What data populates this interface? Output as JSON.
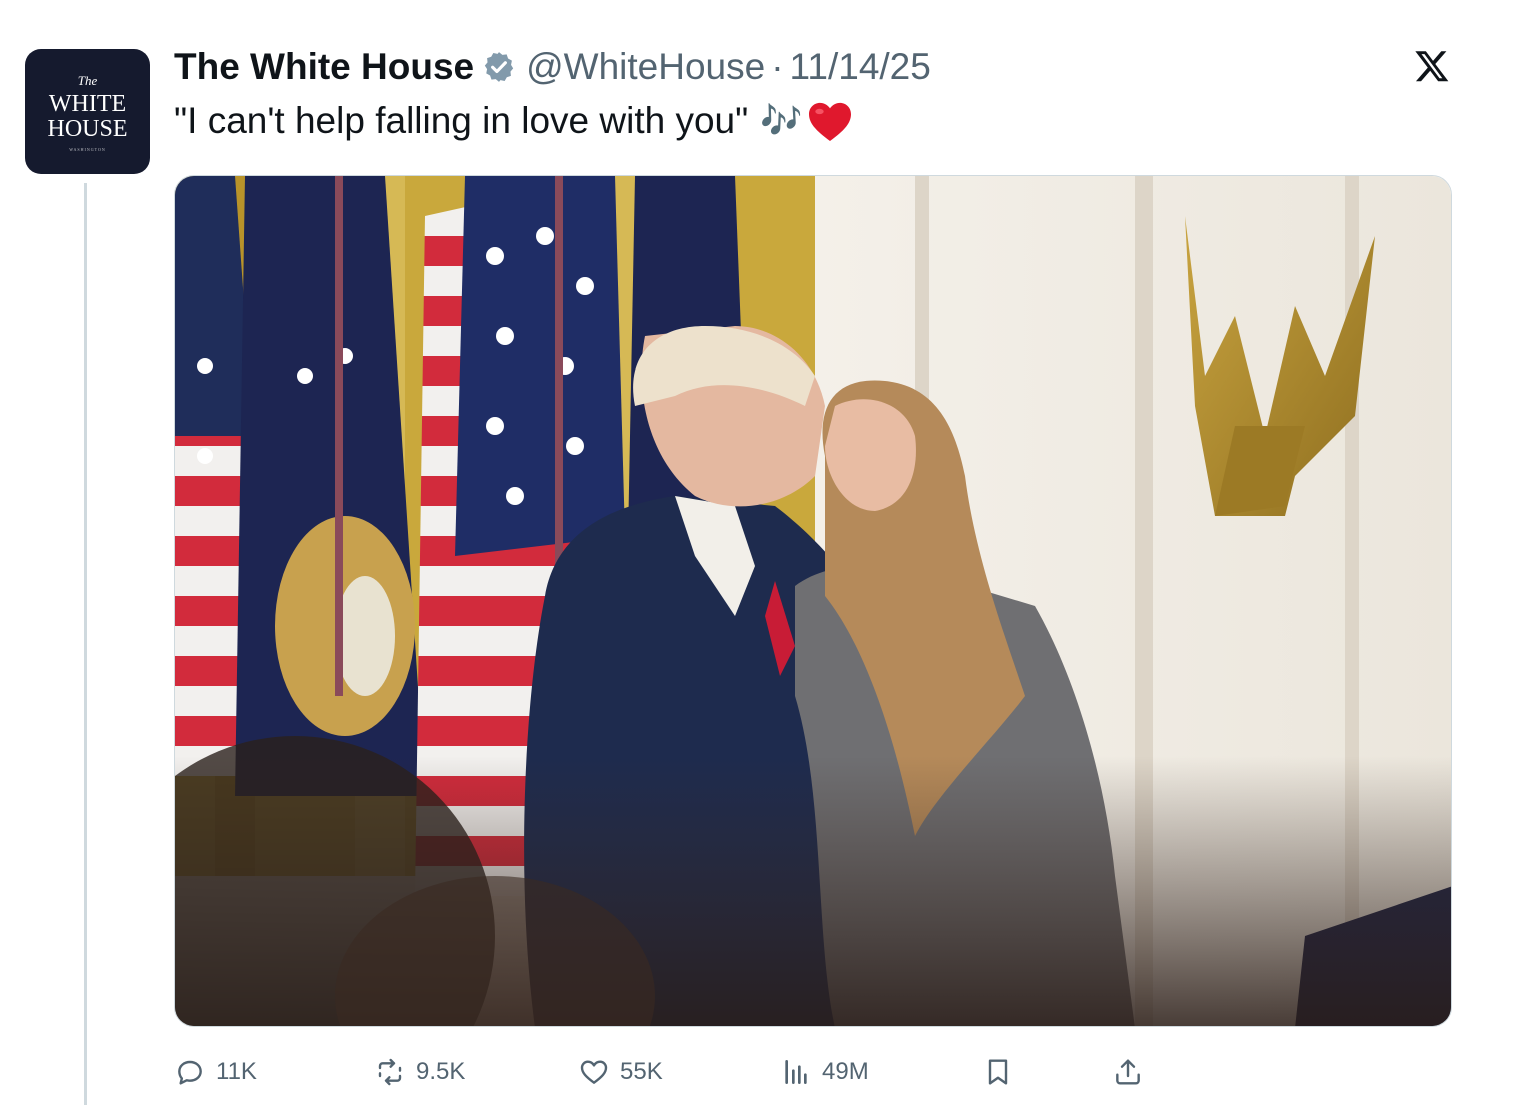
{
  "account": {
    "name": "The White House",
    "handle": "@WhiteHouse",
    "separator": "·",
    "date": "11/14/25",
    "avatar": {
      "the": "The",
      "line1": "WHITE",
      "line2": "HOUSE",
      "line3": "WASHINGTON"
    }
  },
  "tweet": {
    "text": "\"I can't help falling in love with you\"",
    "notes": "🎶",
    "heart": "heart-emoji"
  },
  "media": {
    "alt": "photo"
  },
  "actions": {
    "replies": "11K",
    "reposts": "9.5K",
    "likes": "55K",
    "views": "49M"
  },
  "colors": {
    "text": "#0f1419",
    "secondary": "#536471",
    "verified": "#829aab",
    "heart": "#e0182d",
    "avatar_bg": "#151a2e"
  },
  "icons": [
    "verified-badge-icon",
    "x-logo-icon",
    "reply-icon",
    "repost-icon",
    "like-icon",
    "views-icon",
    "bookmark-icon",
    "share-icon"
  ]
}
